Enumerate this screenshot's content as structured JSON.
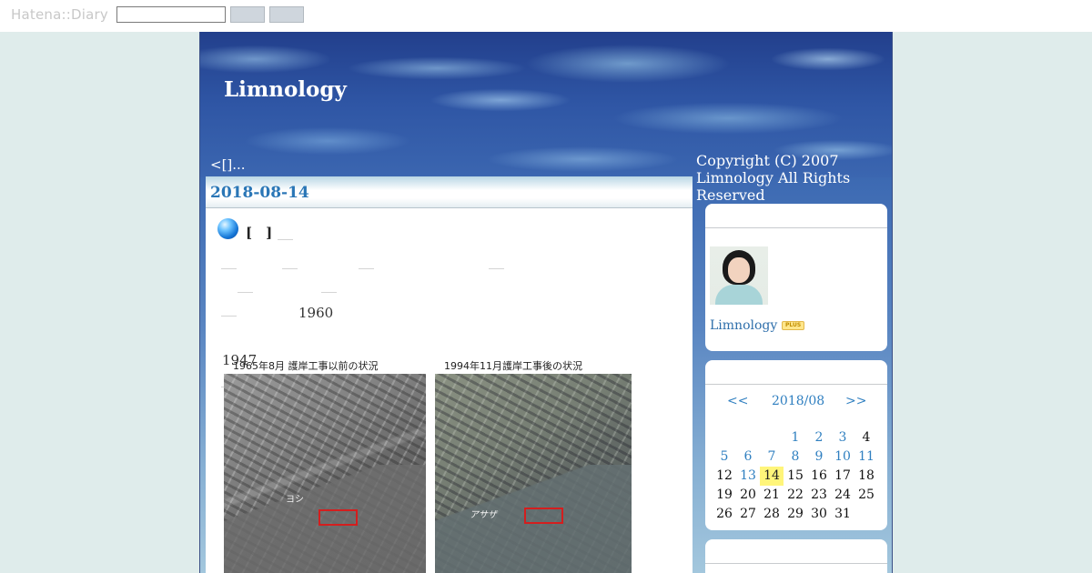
{
  "topbar": {
    "logo": "Hatena::Diary",
    "search_value": ""
  },
  "site": {
    "title": "Limnology",
    "prev_link": "<[]...",
    "copyright": "Copyright (C) 2007 Limnology  All Rights Reserved"
  },
  "entry": {
    "date": "2018-08-14",
    "title": "[　]",
    "text_1960": "1960",
    "text_1947": "1947",
    "photo1": {
      "caption": "1965年8月 護岸工事以前の状況",
      "label": "ヨシ"
    },
    "photo2": {
      "caption": "1994年11月護岸工事後の状況",
      "label": "アサザ"
    }
  },
  "profile": {
    "name": "Limnology",
    "badge": "PLUS"
  },
  "calendar": {
    "prev": "<<",
    "month": "2018/08",
    "next": ">>",
    "days": [
      {
        "d": "",
        "link": false
      },
      {
        "d": "",
        "link": false
      },
      {
        "d": "",
        "link": false
      },
      {
        "d": "1",
        "link": true
      },
      {
        "d": "2",
        "link": true
      },
      {
        "d": "3",
        "link": true
      },
      {
        "d": "4",
        "link": false
      },
      {
        "d": "5",
        "link": true
      },
      {
        "d": "6",
        "link": true
      },
      {
        "d": "7",
        "link": true
      },
      {
        "d": "8",
        "link": true
      },
      {
        "d": "9",
        "link": true
      },
      {
        "d": "10",
        "link": true
      },
      {
        "d": "11",
        "link": true
      },
      {
        "d": "12",
        "link": false
      },
      {
        "d": "13",
        "link": true
      },
      {
        "d": "14",
        "link": false,
        "today": true
      },
      {
        "d": "15",
        "link": false
      },
      {
        "d": "16",
        "link": false
      },
      {
        "d": "17",
        "link": false
      },
      {
        "d": "18",
        "link": false
      },
      {
        "d": "19",
        "link": false
      },
      {
        "d": "20",
        "link": false
      },
      {
        "d": "21",
        "link": false
      },
      {
        "d": "22",
        "link": false
      },
      {
        "d": "23",
        "link": false
      },
      {
        "d": "24",
        "link": false
      },
      {
        "d": "25",
        "link": false
      },
      {
        "d": "26",
        "link": false
      },
      {
        "d": "27",
        "link": false
      },
      {
        "d": "28",
        "link": false
      },
      {
        "d": "29",
        "link": false
      },
      {
        "d": "30",
        "link": false
      },
      {
        "d": "31",
        "link": false
      }
    ]
  }
}
